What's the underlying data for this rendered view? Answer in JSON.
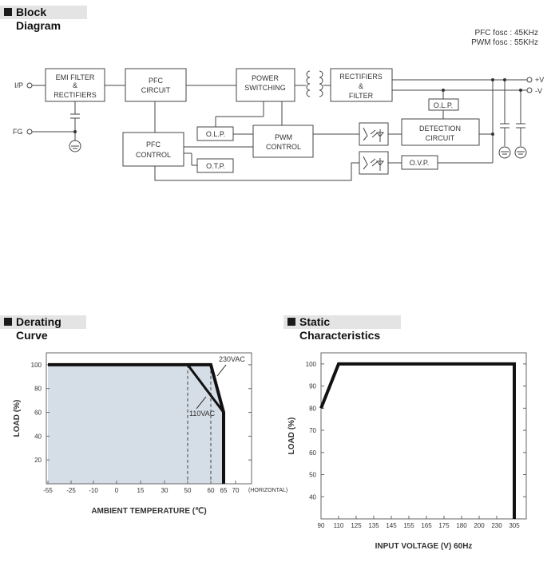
{
  "block_diagram": {
    "heading": "Block Diagram",
    "notes": [
      "PFC fosc : 45KHz",
      "PWM fosc : 55KHz"
    ],
    "terminals": {
      "ip": "I/P",
      "fg": "FG",
      "pos": "+V",
      "neg": "-V"
    },
    "blocks": {
      "emi": [
        "EMI FILTER",
        "&",
        "RECTIFIERS"
      ],
      "pfc_circuit": [
        "PFC",
        "CIRCUIT"
      ],
      "power_switching": [
        "POWER",
        "SWITCHING"
      ],
      "rectifiers": [
        "RECTIFIERS",
        "&",
        "FILTER"
      ],
      "olp_right": "O.L.P.",
      "detection": [
        "DETECTION",
        "CIRCUIT"
      ],
      "ovp": "O.V.P.",
      "pwm_control": [
        "PWM",
        "CONTROL"
      ],
      "olp_left": "O.L.P.",
      "pfc_control": [
        "PFC",
        "CONTROL"
      ],
      "otp": "O.T.P."
    }
  },
  "derating": {
    "heading": "Derating Curve"
  },
  "static": {
    "heading": "Static Characteristics"
  },
  "chart_data": [
    {
      "type": "line",
      "title": "Derating Curve",
      "xlabel": "AMBIENT TEMPERATURE (℃)",
      "ylabel": "LOAD (%)",
      "x_ticks": [
        -55,
        -25,
        -10,
        0,
        15,
        30,
        50,
        60,
        65,
        70
      ],
      "x_tick_note": "(HORIZONTAL)",
      "y_ticks": [
        20,
        40,
        60,
        80,
        100
      ],
      "ylim": [
        0,
        110
      ],
      "fill_color": "#d5dde6",
      "series": [
        {
          "name": "230VAC",
          "x": [
            -55,
            60,
            65,
            65
          ],
          "y": [
            100,
            100,
            60,
            0
          ]
        },
        {
          "name": "110VAC",
          "x": [
            50,
            65
          ],
          "y": [
            100,
            60
          ]
        }
      ],
      "reference_lines_x": [
        50,
        60
      ]
    },
    {
      "type": "line",
      "title": "Static Characteristics",
      "xlabel": "INPUT VOLTAGE (V) 60Hz",
      "ylabel": "LOAD (%)",
      "x_ticks": [
        90,
        110,
        125,
        135,
        145,
        155,
        165,
        175,
        180,
        200,
        230,
        305
      ],
      "y_ticks": [
        40,
        50,
        60,
        70,
        80,
        90,
        100
      ],
      "ylim": [
        30,
        105
      ],
      "series": [
        {
          "x": [
            90,
            110,
            305,
            305
          ],
          "y": [
            80,
            100,
            100,
            30
          ]
        }
      ]
    }
  ]
}
